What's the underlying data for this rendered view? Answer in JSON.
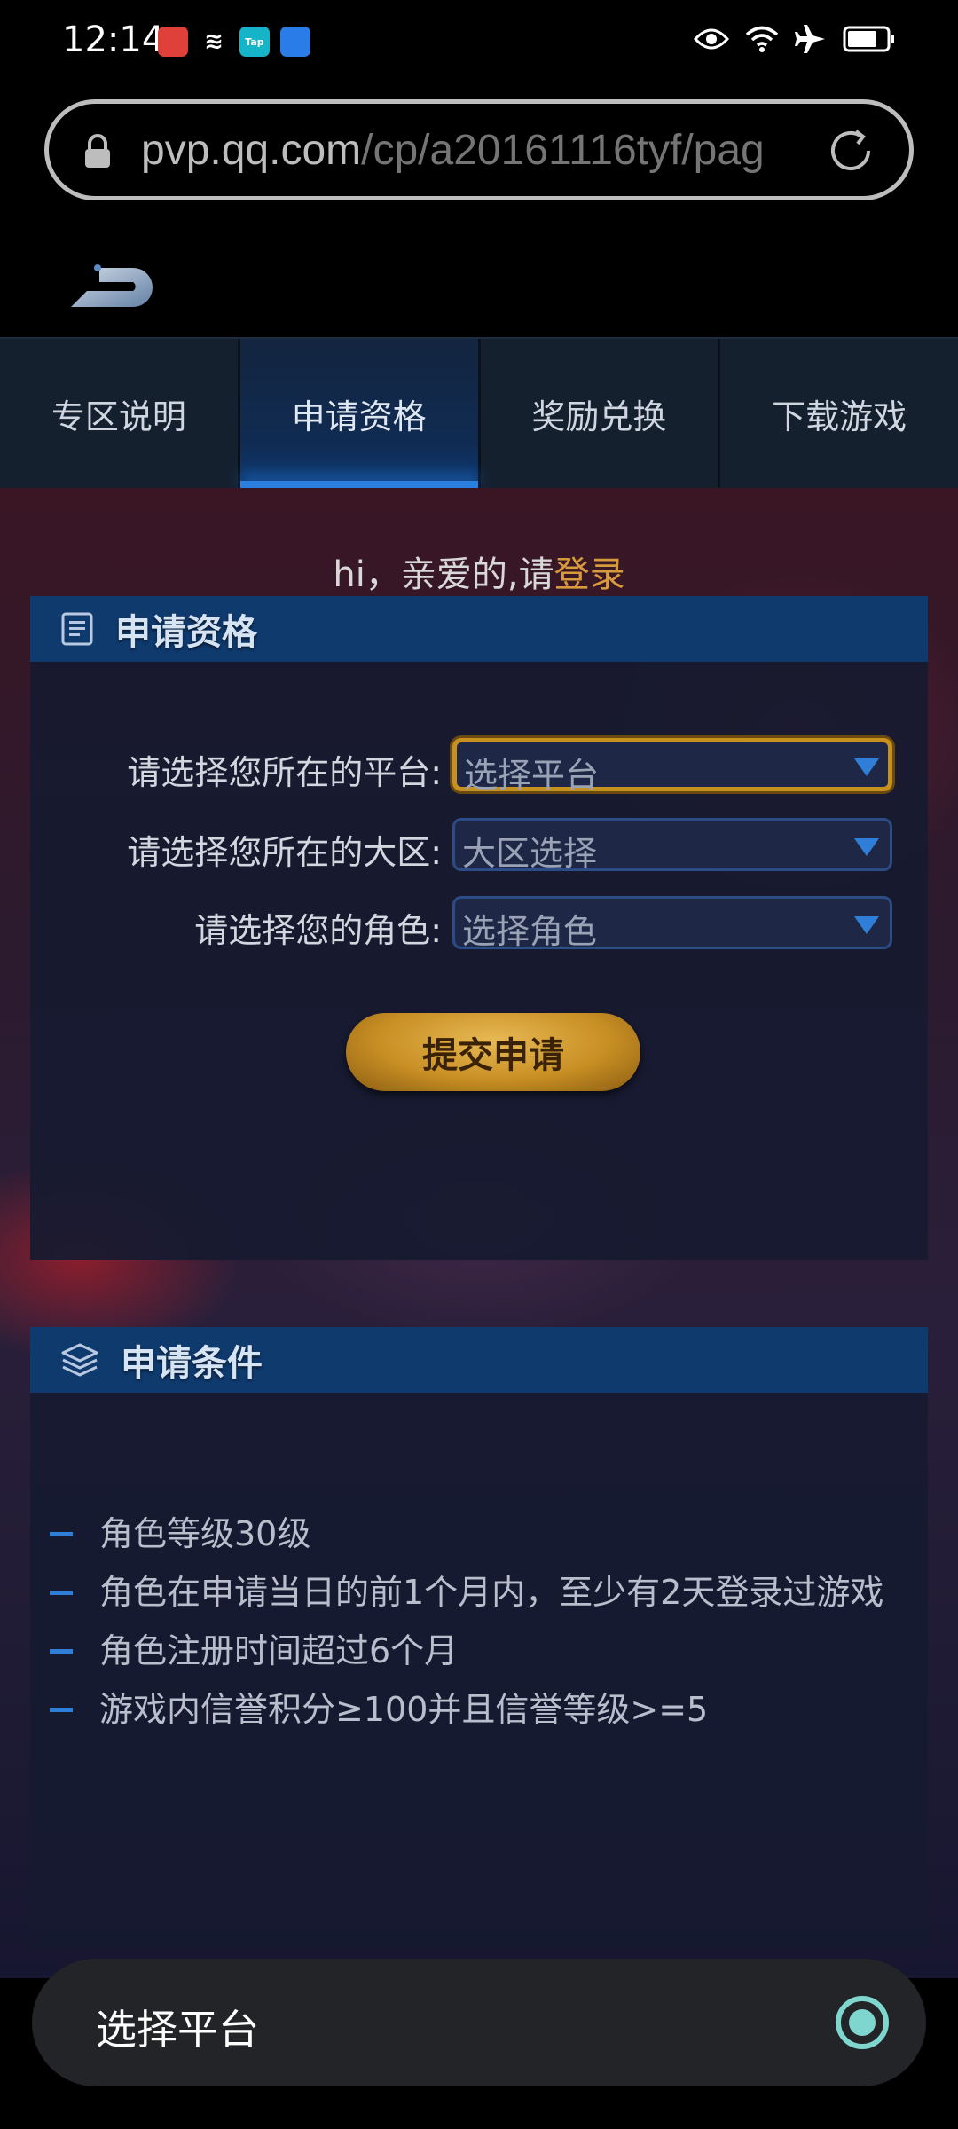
{
  "status_bar": {
    "time": "12:14",
    "notification_icons": [
      "app-icon-red",
      "capcut-icon",
      "taptap-icon",
      "weather-icon"
    ],
    "notif_texts": [
      "",
      "≋",
      "Tap",
      ""
    ],
    "system_icons": [
      "eye-icon",
      "wifi-icon",
      "airplane-icon",
      "battery-icon"
    ]
  },
  "browser": {
    "url_host": "pvp.qq.com",
    "url_path": "/cp/a20161116tyf/pag"
  },
  "tabs": [
    {
      "label": "专区说明",
      "active": false
    },
    {
      "label": "申请资格",
      "active": true
    },
    {
      "label": "奖励兑换",
      "active": false
    },
    {
      "label": "下载游戏",
      "active": false
    }
  ],
  "login": {
    "greeting": "hi，亲爱的,请",
    "link": "登录"
  },
  "apply_panel": {
    "title": "申请资格",
    "fields": [
      {
        "label": "请选择您所在的平台:",
        "placeholder": "选择平台",
        "focused": true
      },
      {
        "label": "请选择您所在的大区:",
        "placeholder": "大区选择",
        "focused": false
      },
      {
        "label": "请选择您的角色:",
        "placeholder": "选择角色",
        "focused": false
      }
    ],
    "submit_label": "提交申请"
  },
  "conditions_panel": {
    "title": "申请条件",
    "items": [
      "角色等级30级",
      "角色在申请当日的前1个月内，至少有2天登录过游戏",
      "角色注册时间超过6个月",
      "游戏内信誉积分≥100并且信誉等级>=5"
    ]
  },
  "picker": {
    "selected_label": "选择平台"
  },
  "colors": {
    "accent_blue": "#2f7fd8",
    "login_link": "#d79a3c",
    "panel_header": "#0f3a6e",
    "button_gold": "#c88f24"
  }
}
